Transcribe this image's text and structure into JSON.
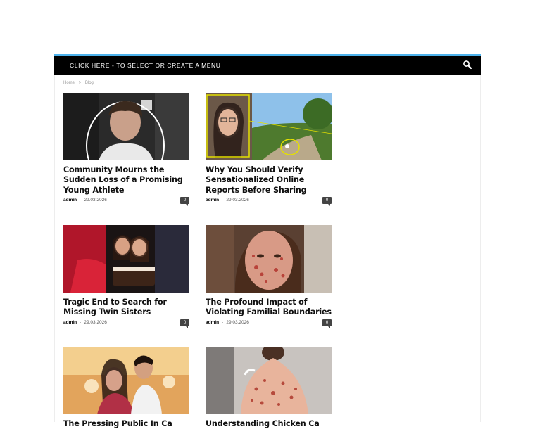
{
  "nav": {
    "menu_label": "CLICK HERE - TO SELECT OR CREATE A MENU",
    "search_icon": "search-icon"
  },
  "breadcrumb": {
    "home": "Home",
    "separator": ">",
    "current": "Blog"
  },
  "posts": [
    {
      "title": "Community Mourns the Sudden Loss of a Promising Young Athlete",
      "author": "admin",
      "separator": "-",
      "date": "29.03.2026",
      "comments": "0"
    },
    {
      "title": "Why You Should Verify Sensationalized Online Reports Before Sharing",
      "author": "admin",
      "separator": "-",
      "date": "29.03.2026",
      "comments": "0"
    },
    {
      "title": "Tragic End to Search for Missing Twin Sisters",
      "author": "admin",
      "separator": "-",
      "date": "29.03.2026",
      "comments": "0"
    },
    {
      "title": "The Profound Impact of Violating Familial Boundaries",
      "author": "admin",
      "separator": "-",
      "date": "29.03.2026",
      "comments": "0"
    },
    {
      "title": "The Pressing Public In Ca",
      "author": "",
      "separator": "",
      "date": "",
      "comments": ""
    },
    {
      "title": "Understanding Chicken Ca",
      "author": "",
      "separator": "",
      "date": "",
      "comments": ""
    }
  ],
  "colors": {
    "navbar": "#000000",
    "accent": "#4db2ec",
    "title": "#111111"
  }
}
